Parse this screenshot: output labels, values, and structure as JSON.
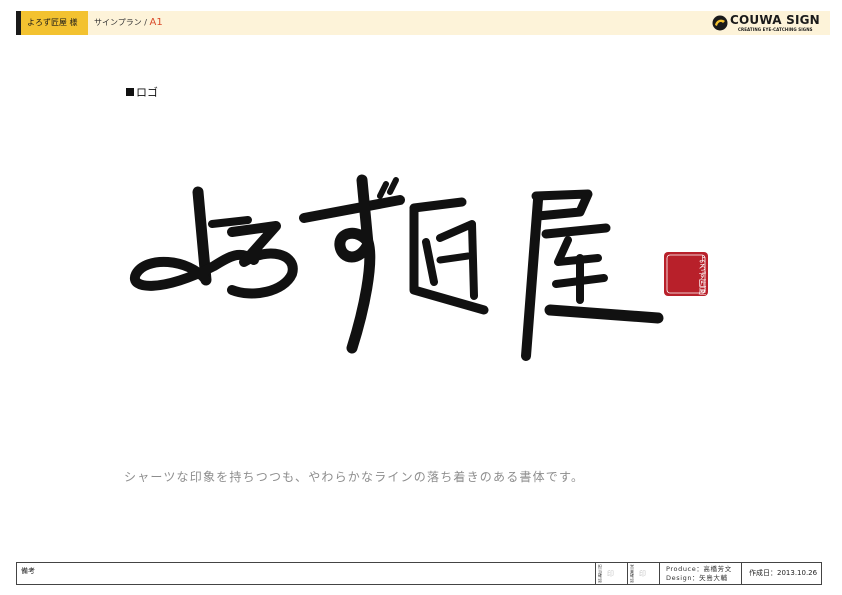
{
  "header": {
    "client": "よろず匠屋 様",
    "plan_title": "サインプラン / ",
    "plan_code": "A1",
    "brand_name": "COUWA SIGN",
    "brand_tagline": "CREATING EYE-CATCHING SIGNS"
  },
  "section": {
    "label": "ロゴ"
  },
  "logo": {
    "text": "よろず匠屋",
    "seal_text": "よろず匠屋",
    "colors": {
      "ink": "#111111",
      "seal": "#b8202a"
    }
  },
  "caption": "シャーツな印象を持ちつつも、やわらかなラインの落ち着きのある書体です。",
  "footer": {
    "remarks_label": "備考",
    "approval_1": "担当確認",
    "approval_2": "営業確認",
    "seal_glyph": "印",
    "produce": "Produce：高橋芳文",
    "design": "Design：矢島大輔",
    "date": "作成日：2013.10.26"
  },
  "colors": {
    "accent": "#f3c230",
    "header_bg": "#fdf3d9",
    "caption": "#8d8d8d"
  }
}
